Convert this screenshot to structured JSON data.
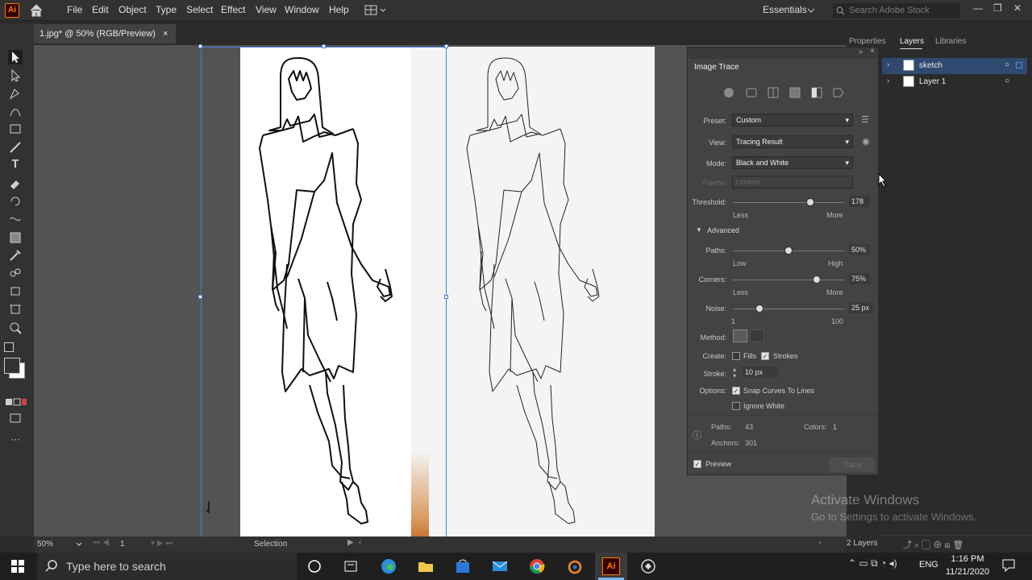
{
  "app": {
    "logo": "Ai",
    "home_icon": "home-icon"
  },
  "menu": [
    "File",
    "Edit",
    "Object",
    "Type",
    "Select",
    "Effect",
    "View",
    "Window",
    "Help"
  ],
  "workspace": "Essentials",
  "search": {
    "placeholder": "Search Adobe Stock"
  },
  "window_controls": [
    "—",
    "❐",
    "✕"
  ],
  "document_tab": {
    "title": "1.jpg* @ 50% (RGB/Preview)",
    "close": "×"
  },
  "status": {
    "zoom": "50%",
    "artboard": "1",
    "tool": "Selection"
  },
  "panel_tabs": [
    "Properties",
    "Layers",
    "Libraries"
  ],
  "layers": [
    {
      "name": "sketch"
    },
    {
      "name": "Layer 1"
    }
  ],
  "layers_count": "2 Layers",
  "image_trace": {
    "title": "Image Trace",
    "preset_label": "Preset:",
    "preset": "Custom",
    "view_label": "View:",
    "view": "Tracing Result",
    "mode_label": "Mode:",
    "mode": "Black and White",
    "palette_label": "Palette:",
    "palette": "Limited",
    "threshold_label": "Threshold:",
    "threshold": "178",
    "threshold_value": 178,
    "threshold_max": 255,
    "threshold_less": "Less",
    "threshold_more": "More",
    "advanced": "Advanced",
    "paths_label": "Paths:",
    "paths": "50%",
    "paths_value": 50,
    "paths_low": "Low",
    "paths_high": "High",
    "corners_label": "Corners:",
    "corners": "75%",
    "corners_value": 75,
    "corners_less": "Less",
    "corners_more": "More",
    "noise_label": "Noise:",
    "noise": "25 px",
    "noise_value": 25,
    "noise_min": "1",
    "noise_max": "100",
    "method_label": "Method:",
    "create_label": "Create:",
    "fills": "Fills",
    "strokes": "Strokes",
    "stroke_label": "Stroke:",
    "stroke": "10 px",
    "options_label": "Options:",
    "snap": "Snap Curves To Lines",
    "ignore_white": "Ignore White",
    "info_paths_label": "Paths:",
    "info_paths": "43",
    "info_colors_label": "Colors:",
    "info_colors": "1",
    "info_anchors_label": "Anchors:",
    "info_anchors": "301",
    "preview": "Preview",
    "trace_button": "Trace"
  },
  "watermark": {
    "line1": "Activate Windows",
    "line2": "Go to Settings to activate Windows."
  },
  "taskbar": {
    "search_placeholder": "Type here to search",
    "language": "ENG",
    "time": "1:16 PM",
    "date": "11/21/2020"
  }
}
